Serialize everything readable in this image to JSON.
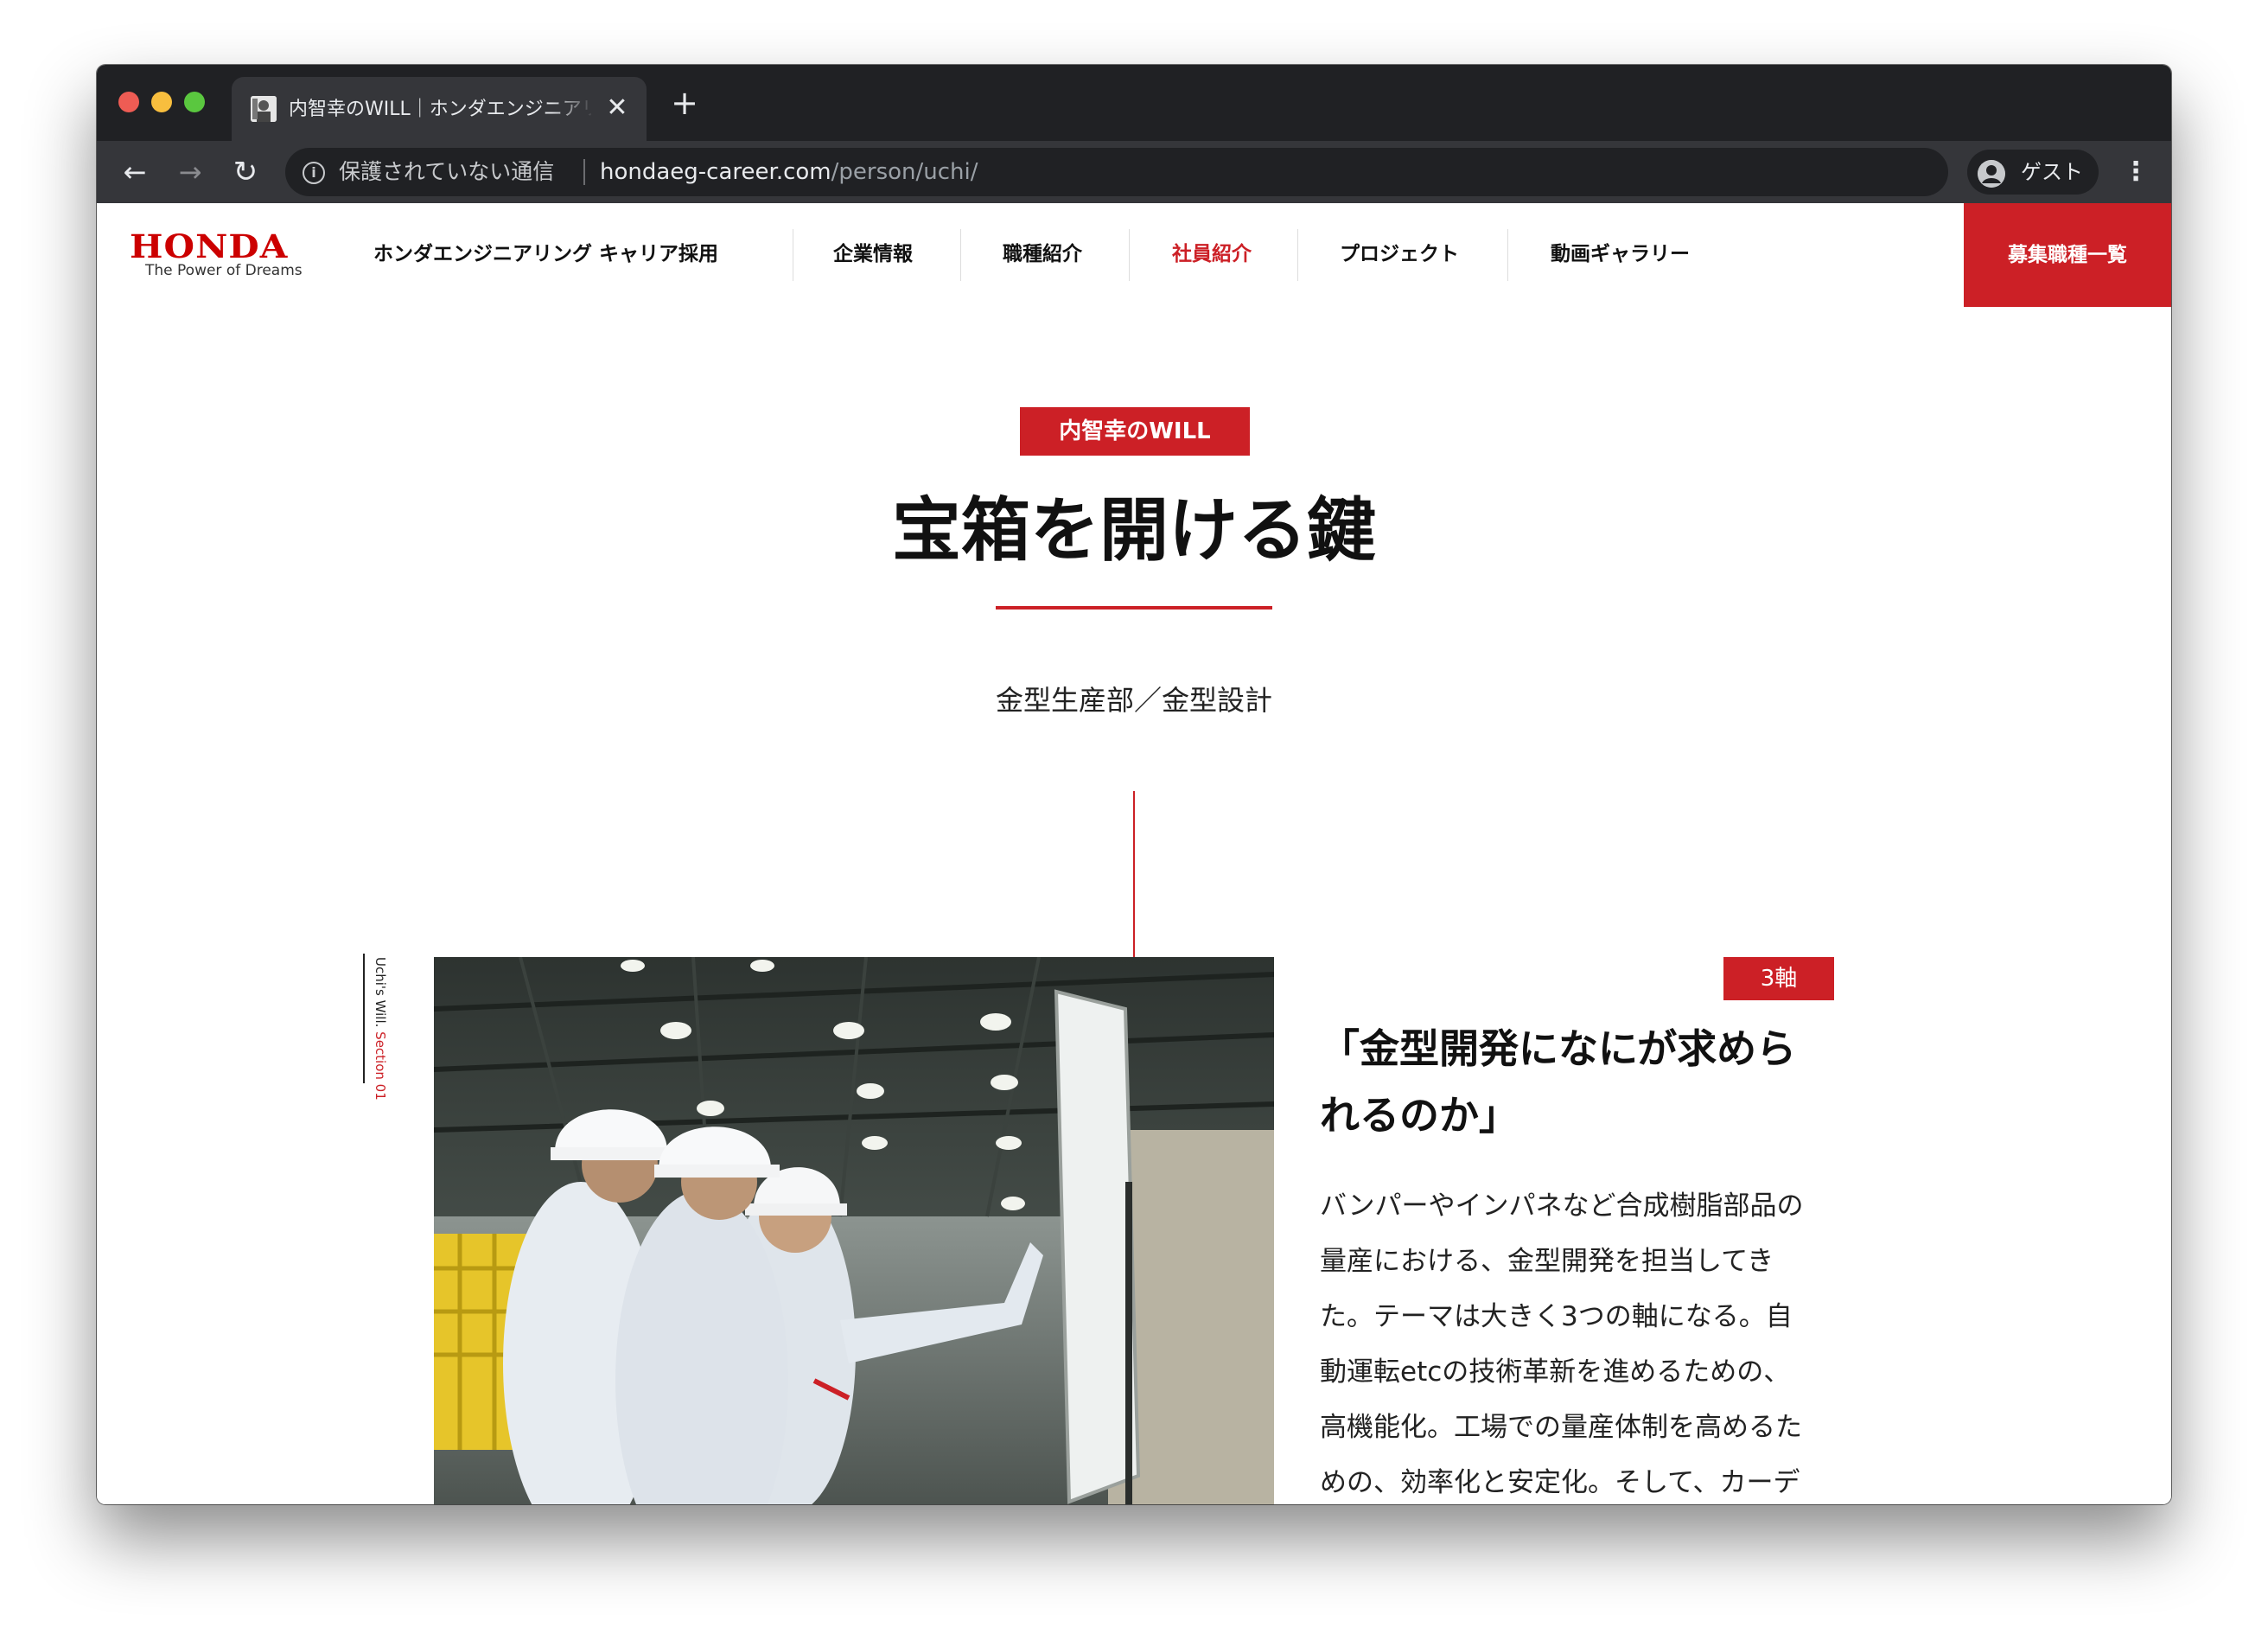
{
  "browser": {
    "tab_title": "内智幸のWILL｜ホンダエンジニアリング キャリア採用",
    "tab_close": "✕",
    "new_tab": "+",
    "back": "←",
    "forward": "→",
    "reload": "↻",
    "security_label": "保護されていない通信",
    "url_host": "hondaeg-career.com",
    "url_path": "/person/uchi/",
    "profile_label": "ゲスト",
    "menu": "⋮"
  },
  "header": {
    "logo_word": "HONDA",
    "logo_tagline": "The Power of Dreams",
    "site_name": "ホンダエンジニアリング キャリア採用",
    "nav": [
      {
        "label": "企業情報"
      },
      {
        "label": "職種紹介"
      },
      {
        "label": "社員紹介"
      },
      {
        "label": "プロジェクト"
      },
      {
        "label": "動画ギャラリー"
      }
    ],
    "cta_label": "募集職種一覧"
  },
  "hero": {
    "badge": "内智幸のWILL",
    "title": "宝箱を開ける鍵",
    "department": "金型生産部／金型設計"
  },
  "section": {
    "side_label": "Uchi's Will.",
    "side_label_section": "Section 01",
    "axis_badge": "3軸",
    "heading_line1": "「金型開発になにが求めら",
    "heading_line2": "れるのか」",
    "body_lines": [
      "バンパーやインパネなど合成樹脂部品の",
      "量産における、金型開発を担当してき",
      "た。テーマは大きく3つの軸になる。自",
      "動運転etcの技術革新を進めるための、",
      "高機能化。工場での量産体制を高めるた",
      "めの、効率化と安定化。そして、カーデ"
    ]
  },
  "colors": {
    "brand_red": "#cc2026",
    "chrome_dark": "#202124",
    "chrome_mid": "#35363a"
  },
  "icons": {
    "info": "info-icon",
    "profile": "profile-icon"
  }
}
